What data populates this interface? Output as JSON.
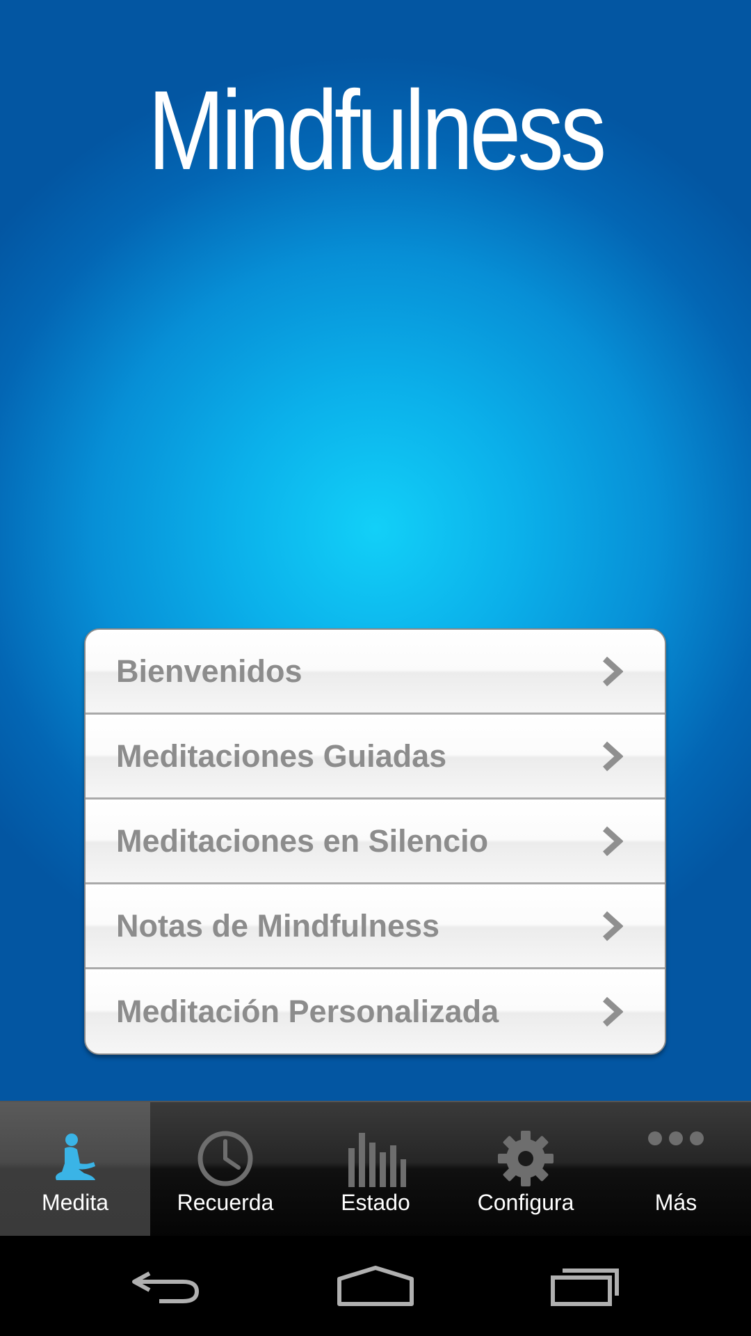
{
  "app": {
    "title": "Mindfulness"
  },
  "menu": {
    "items": [
      {
        "label": "Bienvenidos"
      },
      {
        "label": "Meditaciones Guiadas"
      },
      {
        "label": "Meditaciones en Silencio"
      },
      {
        "label": "Notas de Mindfulness"
      },
      {
        "label": "Meditación Personalizada"
      }
    ]
  },
  "tabs": [
    {
      "label": "Medita",
      "icon": "meditation-icon",
      "active": true
    },
    {
      "label": "Recuerda",
      "icon": "clock-icon",
      "active": false
    },
    {
      "label": "Estado",
      "icon": "bars-icon",
      "active": false
    },
    {
      "label": "Configura",
      "icon": "gear-icon",
      "active": false
    },
    {
      "label": "Más",
      "icon": "more-dots-icon",
      "active": false
    }
  ],
  "navigation": {
    "buttons": [
      "back-icon",
      "home-icon",
      "recent-apps-icon"
    ]
  },
  "colors": {
    "accent": "#12d0f8",
    "background_dark": "#0356a2",
    "menu_text": "#8c8c8c",
    "tab_active_icon": "#3ab4e6"
  }
}
